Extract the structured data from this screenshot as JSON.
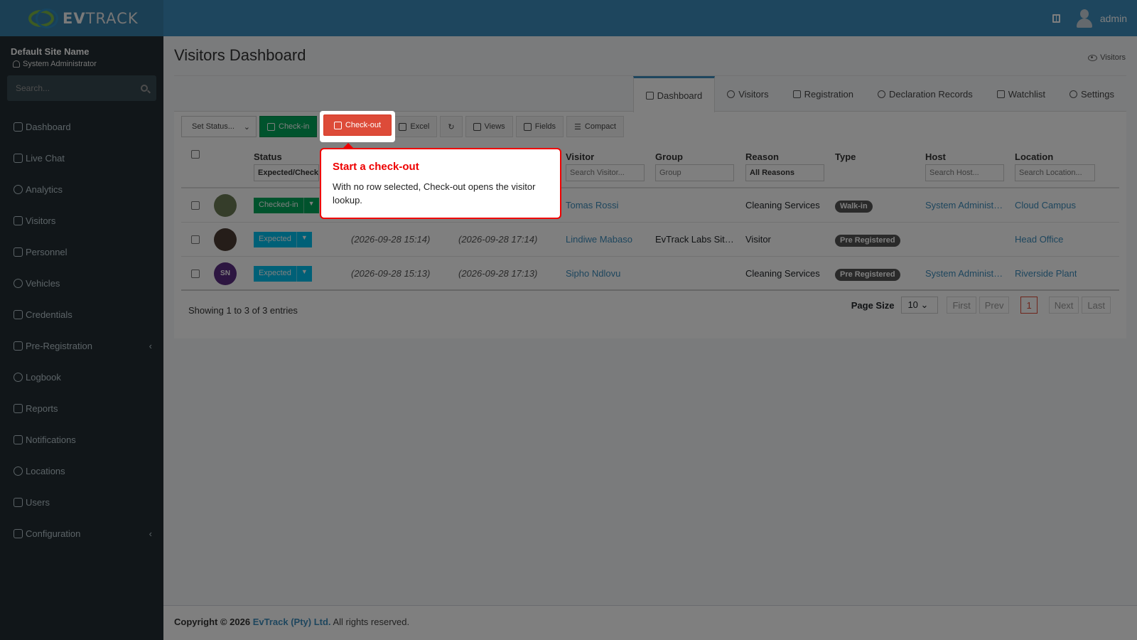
{
  "brand": {
    "logo_text_bold": "EV",
    "logo_text": "TRACK"
  },
  "header": {
    "user": "admin"
  },
  "sidebar": {
    "site_name": "Default Site Name",
    "role": "System Administrator",
    "search_placeholder": "Search...",
    "items": [
      {
        "label": "Dashboard",
        "icon": "dashboard-icon"
      },
      {
        "label": "Live Chat",
        "icon": "headset-icon"
      },
      {
        "label": "Analytics",
        "icon": "analytics-icon"
      },
      {
        "label": "Visitors",
        "icon": "eye-icon"
      },
      {
        "label": "Personnel",
        "icon": "personnel-icon"
      },
      {
        "label": "Vehicles",
        "icon": "car-icon"
      },
      {
        "label": "Credentials",
        "icon": "credentials-icon"
      },
      {
        "label": "Pre-Registration",
        "icon": "exchange-icon",
        "chevron": "‹"
      },
      {
        "label": "Logbook",
        "icon": "book-icon"
      },
      {
        "label": "Reports",
        "icon": "reports-icon"
      },
      {
        "label": "Notifications",
        "icon": "notifications-icon"
      },
      {
        "label": "Locations",
        "icon": "map-icon"
      },
      {
        "label": "Users",
        "icon": "users-icon"
      },
      {
        "label": "Configuration",
        "icon": "cog-icon",
        "chevron": "‹"
      }
    ]
  },
  "page": {
    "title": "Visitors Dashboard",
    "breadcrumb": "Visitors"
  },
  "tabs": [
    {
      "label": "Dashboard",
      "active": true
    },
    {
      "label": "Visitors"
    },
    {
      "label": "Registration"
    },
    {
      "label": "Declaration Records"
    },
    {
      "label": "Watchlist"
    },
    {
      "label": "Settings"
    }
  ],
  "toolbar": {
    "set_status": "Set Status...",
    "checkin": "Check-in",
    "checkout": "Check-out",
    "excel": "Excel",
    "views": "Views",
    "fields": "Fields",
    "compact": "Compact"
  },
  "table": {
    "headers": {
      "status": "Status",
      "visitor": "Visitor",
      "group": "Group",
      "reason": "Reason",
      "type": "Type",
      "host": "Host",
      "location": "Location"
    },
    "filters": {
      "status": "Expected/Check",
      "visitor": "Search Visitor...",
      "group": "Group",
      "reason": "All Reasons",
      "host": "Search Host...",
      "location": "Search Location..."
    },
    "rows": [
      {
        "status": "Checked-in",
        "arrival": "",
        "departure": "",
        "visitor": "Tomas Rossi",
        "group": "",
        "reason": "Cleaning Services",
        "type": "Walk-in",
        "host": "System Administ…",
        "location": "Cloud Campus",
        "initials": ""
      },
      {
        "status": "Expected",
        "arrival": "(2026-09-28 15:14)",
        "departure": "(2026-09-28 17:14)",
        "visitor": "Lindiwe Mabaso",
        "group": "EvTrack Labs Sit…",
        "reason": "Visitor",
        "type": "Pre Registered",
        "host": "",
        "location": "Head Office",
        "initials": ""
      },
      {
        "status": "Expected",
        "arrival": "(2026-09-28 15:13)",
        "departure": "(2026-09-28 17:13)",
        "visitor": "Sipho Ndlovu",
        "group": "",
        "reason": "Cleaning Services",
        "type": "Pre Registered",
        "host": "System Administ…",
        "location": "Riverside Plant",
        "initials": "SN"
      }
    ],
    "info": "Showing 1 to 3 of 3 entries",
    "pager": {
      "label": "Page Size",
      "size": "10",
      "first": "First",
      "prev": "Prev",
      "current": "1",
      "next": "Next",
      "last": "Last"
    }
  },
  "tooltip": {
    "title": "Start a check-out",
    "body": "With no row selected, Check-out opens the visitor lookup."
  },
  "footer": {
    "copyright": "Copyright © 2026",
    "company": "EvTrack (Pty) Ltd.",
    "rights": "All rights reserved."
  }
}
